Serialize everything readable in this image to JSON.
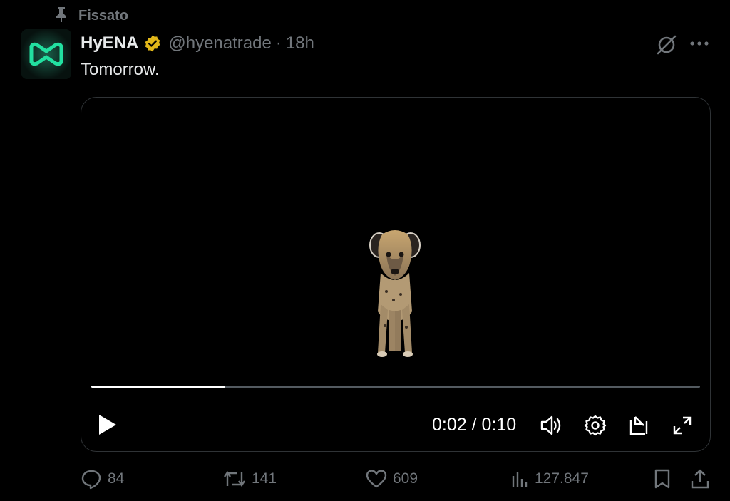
{
  "pinned": {
    "label": "Fissato",
    "icon": "pin-icon"
  },
  "post": {
    "author_name": "HyENA",
    "verified_icon": "verified-gold-badge-icon",
    "handle": "@hyenatrade",
    "separator": "·",
    "time": "18h",
    "text": "Tomorrow."
  },
  "video": {
    "current_time": "0:02",
    "duration": "0:10",
    "time_separator": " / ",
    "progress_fraction": 0.22,
    "controls": [
      "play-icon",
      "volume-icon",
      "settings-icon",
      "pop-out-icon",
      "fullscreen-icon"
    ]
  },
  "actions": {
    "replies": "84",
    "reposts": "141",
    "likes": "609",
    "views": "127.847"
  },
  "colors": {
    "background": "#000000",
    "text": "#e7e9ea",
    "muted": "#71767b",
    "verified": "#e2b719",
    "avatar_accent": "#1fd79a"
  }
}
